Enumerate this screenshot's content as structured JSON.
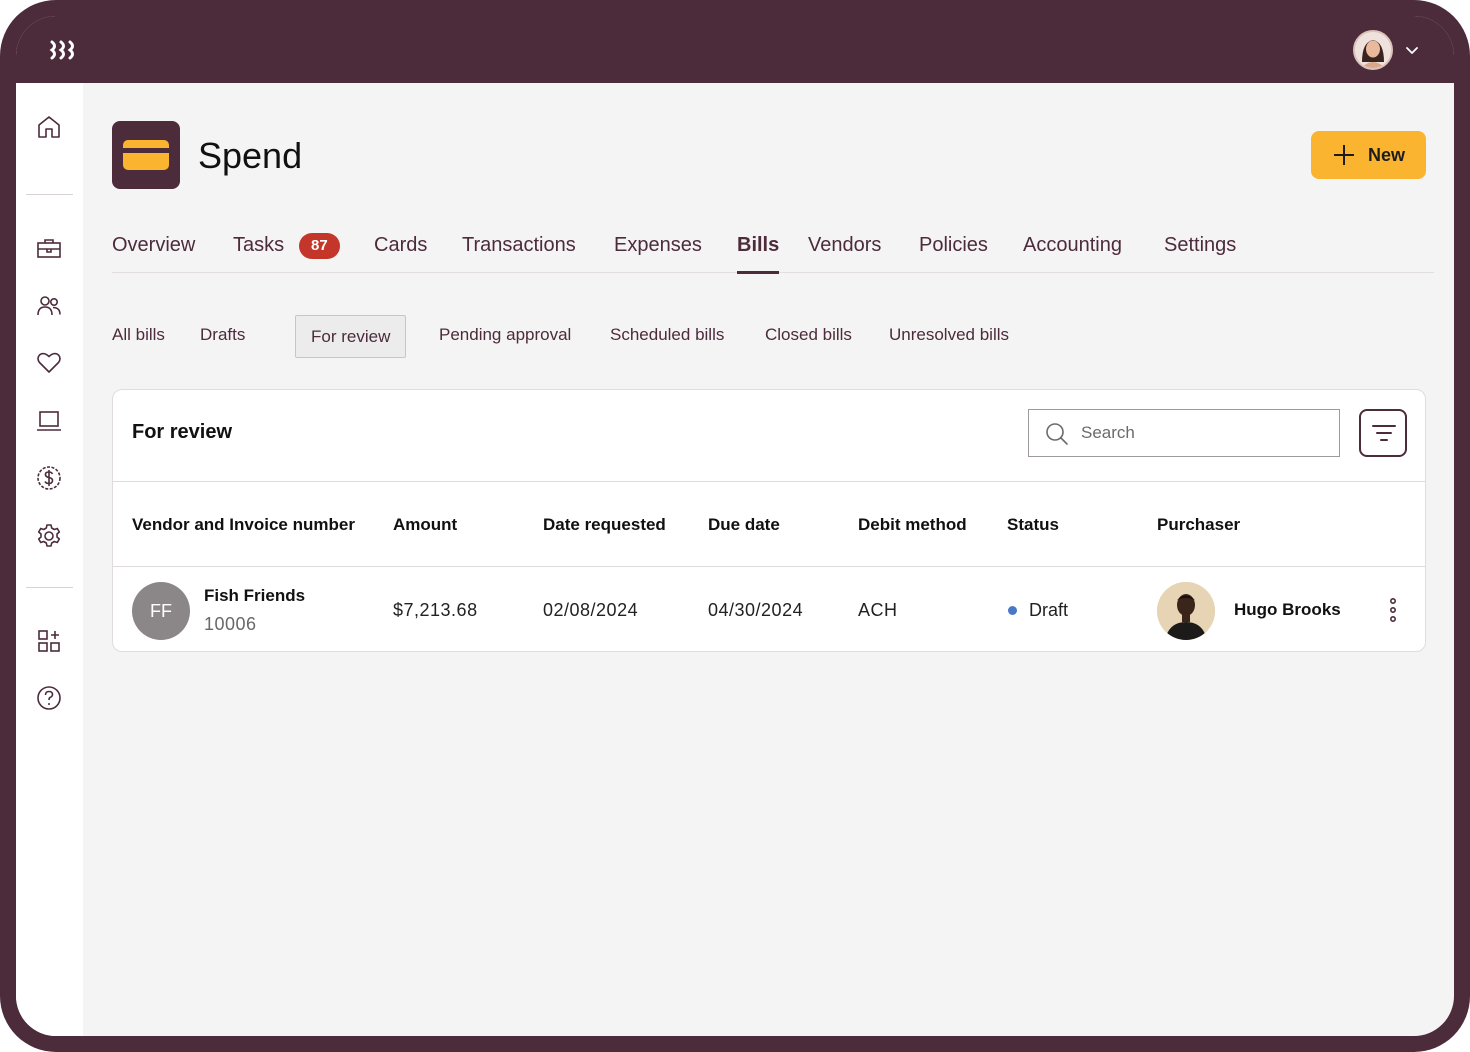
{
  "app": {
    "title": "Spend",
    "new_button_label": "New"
  },
  "tabs": [
    {
      "label": "Overview"
    },
    {
      "label": "Tasks",
      "badge": "87"
    },
    {
      "label": "Cards"
    },
    {
      "label": "Transactions"
    },
    {
      "label": "Expenses"
    },
    {
      "label": "Bills",
      "active": true
    },
    {
      "label": "Vendors"
    },
    {
      "label": "Policies"
    },
    {
      "label": "Accounting"
    },
    {
      "label": "Settings"
    }
  ],
  "subtabs": [
    {
      "label": "All bills"
    },
    {
      "label": "Drafts"
    },
    {
      "label": "For review",
      "active": true
    },
    {
      "label": "Pending approval"
    },
    {
      "label": "Scheduled bills"
    },
    {
      "label": "Closed bills"
    },
    {
      "label": "Unresolved bills"
    }
  ],
  "panel": {
    "title": "For review",
    "search_placeholder": "Search"
  },
  "table": {
    "columns": [
      "Vendor and Invoice number",
      "Amount",
      "Date requested",
      "Due date",
      "Debit method",
      "Status",
      "Purchaser"
    ],
    "rows": [
      {
        "vendor_initials": "FF",
        "vendor_name": "Fish Friends",
        "invoice_number": "10006",
        "amount": "$7,213.68",
        "date_requested": "02/08/2024",
        "due_date": "04/30/2024",
        "debit_method": "ACH",
        "status": "Draft",
        "purchaser": "Hugo Brooks"
      }
    ]
  },
  "colors": {
    "brand": "#4c2b3b",
    "accent": "#fbb430",
    "badge": "#c4362a",
    "status_draft": "#4a78c9"
  },
  "icons": {
    "sidebar": [
      "home-icon",
      "briefcase-icon",
      "users-icon",
      "heart-icon",
      "laptop-icon",
      "dollar-icon",
      "gear-icon",
      "apps-add-icon",
      "help-icon"
    ]
  }
}
